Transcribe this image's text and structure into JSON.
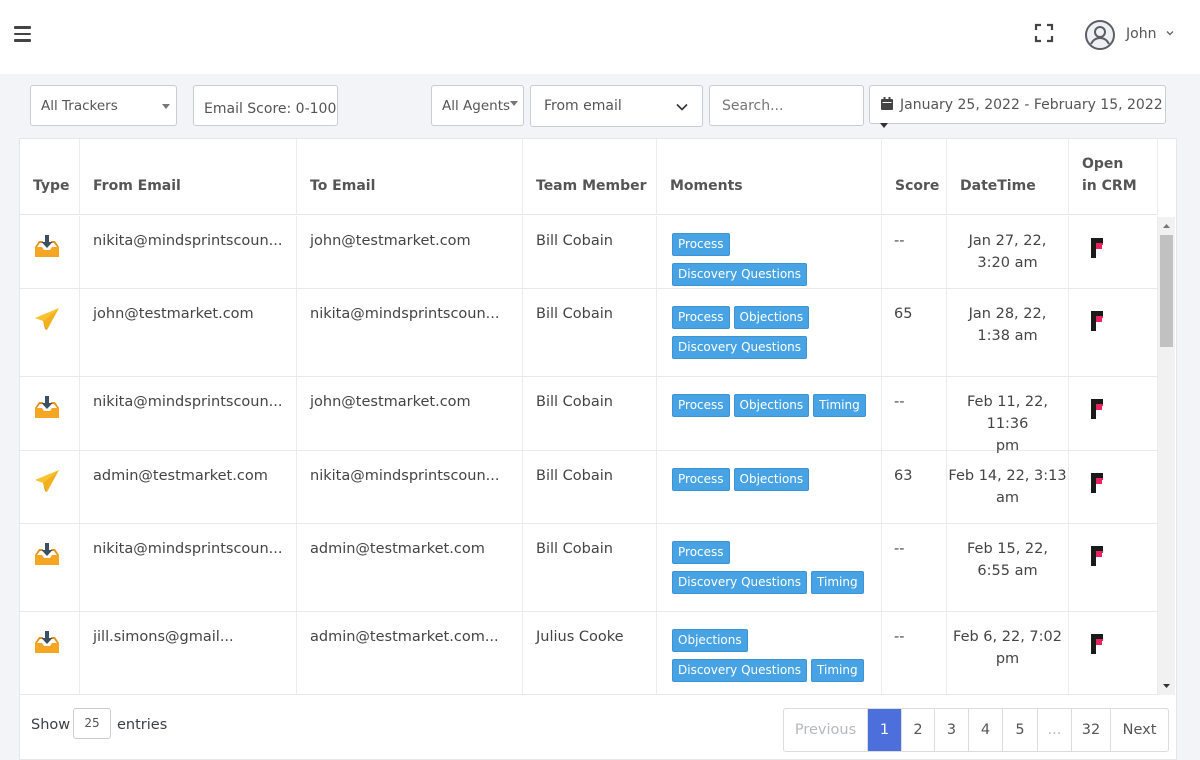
{
  "header": {
    "user_name": "John"
  },
  "filters": {
    "trackers": "All Trackers",
    "email_score": "Email Score: 0-100",
    "agents": "All Agents",
    "direction": "From email",
    "search_placeholder": "Search...",
    "date_range": "January 25, 2022 - February 15, 2022"
  },
  "table": {
    "columns": [
      "Type",
      "From Email",
      "To Email",
      "Team Member",
      "Moments",
      "Score",
      "DateTime",
      "Open in CRM"
    ],
    "rows": [
      {
        "type": "inbox-download-icon",
        "from": "nikita@mindsprintscoun...",
        "to": "john@testmarket.com",
        "member": "Bill Cobain",
        "moments": [
          "Process",
          "Discovery Questions"
        ],
        "score": "--",
        "datetime_1": "Jan 27, 22,",
        "datetime_2": "3:20 am"
      },
      {
        "type": "paper-plane-icon",
        "from": "john@testmarket.com",
        "to": "nikita@mindsprintscoun...",
        "member": "Bill Cobain",
        "moments": [
          "Process",
          "Objections",
          "Discovery Questions"
        ],
        "score": "65",
        "datetime_1": "Jan 28, 22,",
        "datetime_2": "1:38 am"
      },
      {
        "type": "inbox-download-icon",
        "from": "nikita@mindsprintscoun...",
        "to": "john@testmarket.com",
        "member": "Bill Cobain",
        "moments": [
          "Process",
          "Objections",
          "Timing"
        ],
        "score": "--",
        "datetime_1": "Feb 11, 22, 11:36",
        "datetime_2": "pm"
      },
      {
        "type": "paper-plane-icon",
        "from": "admin@testmarket.com",
        "to": "nikita@mindsprintscoun...",
        "member": "Bill Cobain",
        "moments": [
          "Process",
          "Objections"
        ],
        "score": "63",
        "datetime_1": "Feb 14, 22, 3:13",
        "datetime_2": "am"
      },
      {
        "type": "inbox-download-icon",
        "from": "nikita@mindsprintscoun...",
        "to": "admin@testmarket.com",
        "member": "Bill Cobain",
        "moments": [
          "Process",
          "Discovery Questions",
          "Timing"
        ],
        "score": "--",
        "datetime_1": "Feb 15, 22,",
        "datetime_2": "6:55 am"
      },
      {
        "type": "inbox-download-icon",
        "from": "jill.simons@gmail...",
        "to": "admin@testmarket.com...",
        "member": "Julius Cooke",
        "moments": [
          "Objections",
          "Discovery Questions",
          "Timing"
        ],
        "score": "--",
        "datetime_1": "Feb 6, 22, 7:02",
        "datetime_2": "pm"
      }
    ]
  },
  "footer": {
    "show_label": "Show",
    "entries_value": "25",
    "entries_label": "entries",
    "pagination": [
      "Previous",
      "1",
      "2",
      "3",
      "4",
      "5",
      "...",
      "32",
      "Next"
    ]
  },
  "colors": {
    "tag": "#47a3e4",
    "active_page": "#4d6fdc",
    "inbox_icon": "#f5a623",
    "plane_icon": "#f7c22b",
    "crm_icon_pink": "#e8245c"
  }
}
